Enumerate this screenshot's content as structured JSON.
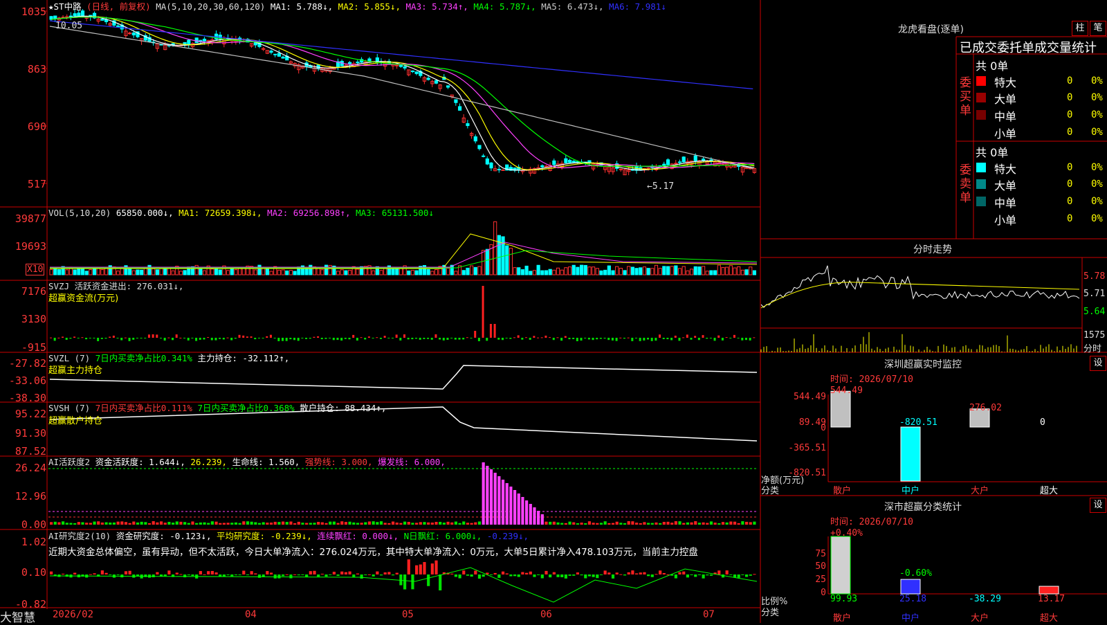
{
  "brand": "大智慧",
  "price_panel": {
    "title_star": "★ST中路",
    "title_mode": "(日线, 前复权)",
    "ma_label": "MA(5,10,20,30,60,120)",
    "ma1": "MA1: 5.788↓,",
    "ma2": "MA2: 5.855↓,",
    "ma3": "MA3: 5.734↑,",
    "ma4": "MA4: 5.787↓,",
    "ma5": "MA5: 6.473↓,",
    "ma6": "MA6: 7.981↓",
    "axis": [
      "1035",
      "863",
      "690",
      "517"
    ],
    "high_note": "10.05",
    "low_note": "←5.17",
    "colors": {
      "ma1": "#ffffff",
      "ma2": "#ffff00",
      "ma3": "#ff40ff",
      "ma4": "#00ff00",
      "ma5": "#c0c0c0",
      "ma6": "#3030ff",
      "up": "#ff3030",
      "down": "#00ffff"
    }
  },
  "vol_panel": {
    "label": "VOL(5,10,20)",
    "val": "65850.000↓,",
    "ma1": "MA1: 72659.398↓,",
    "ma2": "MA2: 69256.898↑,",
    "ma3": "MA3: 65131.500↓",
    "axis": [
      "39877",
      "19693"
    ],
    "unit": "X10"
  },
  "svzj_panel": {
    "label": "SVZJ  活跃资金进出: 276.031↓,",
    "sub": "超赢资金流(万元)",
    "axis": [
      "7176",
      "3130",
      "-915"
    ]
  },
  "svzl_panel": {
    "label_a": "SVZL (7)",
    "label_b": "7日内买卖净占比0.341%",
    "label_c": "主力持仓: -32.112↑,",
    "sub": "超赢主力持仓",
    "axis": [
      "-27.82",
      "-33.06",
      "-38.30"
    ]
  },
  "svsh_panel": {
    "label_a": "SVSH (7)",
    "label_b": "7日内买卖净占比0.111%",
    "label_c": "7日内买卖净占比0.368%",
    "label_d": "散户持仓: 88.434↑,",
    "sub": "超赢散户持仓",
    "axis": [
      "95.22",
      "91.30",
      "87.52"
    ]
  },
  "ai_panel": {
    "label_a": "AI活跃度2",
    "label_b": "资金活跃度: 1.644↓,",
    "label_c": "26.239,",
    "label_d": "生命线: 1.560,",
    "label_e": "强势线: 3.000,",
    "label_f": "爆发线: 6.000,",
    "axis": [
      "26.24",
      "12.96",
      "0.00"
    ]
  },
  "ai2_panel": {
    "label_a": "AI研究度2(10)",
    "label_b": "资金研究度: -0.123↓,",
    "label_c": "平均研究度: -0.239↓,",
    "label_d": "连续飘红: 0.000↓,",
    "label_e": "N日飘红: 6.000↓,",
    "label_f": "-0.239↓,",
    "comment": "近期大资金总体偏空，虽有异动，但不太活跃，今日大单净流入：276.024万元，其中特大单净流入：0万元，大单5日累计净入478.103万元，当前主力控盘",
    "axis": [
      "1.02",
      "0.10",
      "-0.82"
    ]
  },
  "dates": [
    "2026/02",
    "04",
    "05",
    "06",
    "07"
  ],
  "lhb": {
    "title": "龙虎看盘(逐单)",
    "btn_a": "柱",
    "btn_b": "笔",
    "header": "已成交委托单成交量统计",
    "buy_title": "委买单",
    "sell_title": "委卖单",
    "buy_total": "共 0单",
    "sell_total": "共 0单",
    "rows": [
      "特大",
      "大单",
      "中单",
      "小单"
    ],
    "buy_vals": [
      "0",
      "0",
      "0",
      "0"
    ],
    "buy_pcts": [
      "0%",
      "0%",
      "0%",
      "0%"
    ],
    "sell_vals": [
      "0",
      "0",
      "0",
      "0"
    ],
    "sell_pcts": [
      "0%",
      "0%",
      "0%",
      "0%"
    ]
  },
  "fenshi": {
    "title": "分时走势",
    "axis": [
      "5.78",
      "5.71",
      "5.64"
    ],
    "vol_axis": "1575",
    "vol_unit": "分时"
  },
  "sz_monitor": {
    "title": "深圳超赢实时监控",
    "btn": "设",
    "date": "时间: 2026/07/10",
    "axis": [
      "544.49",
      "89.49",
      "0",
      "-365.51",
      "-820.51"
    ],
    "y_title": "净额(万元)",
    "x_title": "分类",
    "cats": [
      "散户",
      "中户",
      "大户",
      "超大"
    ],
    "values": [
      544.49,
      -820.51,
      276.02,
      0
    ],
    "value_labels": [
      "544.49",
      "-820.51",
      "276.02",
      "0"
    ]
  },
  "sz_class": {
    "title": "深市超赢分类统计",
    "btn": "设",
    "date": "时间: 2026/07/10",
    "axis": [
      "75",
      "50",
      "25",
      "0"
    ],
    "y_title": "比例%",
    "x_title": "分类",
    "cats": [
      "散户",
      "中户",
      "大户",
      "超大"
    ],
    "pct_labels": [
      "+0.40%",
      "-0.60%"
    ],
    "bottom_vals": [
      "99.93",
      "25.18",
      "-38.29",
      "13.17"
    ],
    "values": [
      99.93,
      25.18,
      0,
      13.17
    ]
  }
}
